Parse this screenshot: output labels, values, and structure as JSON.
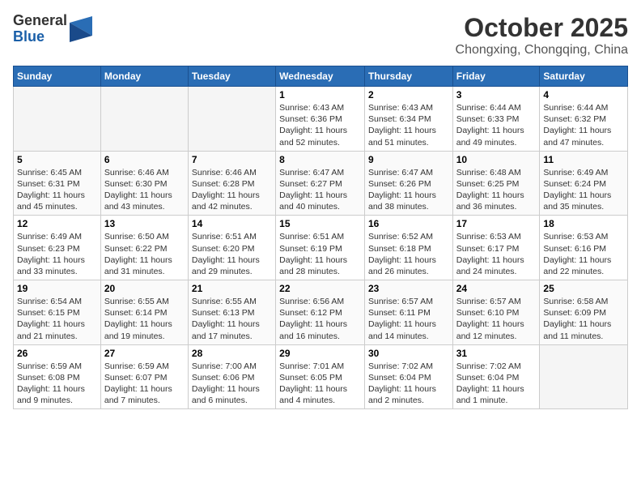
{
  "header": {
    "logo_general": "General",
    "logo_blue": "Blue",
    "month_title": "October 2025",
    "subtitle": "Chongxing, Chongqing, China"
  },
  "weekdays": [
    "Sunday",
    "Monday",
    "Tuesday",
    "Wednesday",
    "Thursday",
    "Friday",
    "Saturday"
  ],
  "weeks": [
    [
      {
        "day": "",
        "info": ""
      },
      {
        "day": "",
        "info": ""
      },
      {
        "day": "",
        "info": ""
      },
      {
        "day": "1",
        "info": "Sunrise: 6:43 AM\nSunset: 6:36 PM\nDaylight: 11 hours\nand 52 minutes."
      },
      {
        "day": "2",
        "info": "Sunrise: 6:43 AM\nSunset: 6:34 PM\nDaylight: 11 hours\nand 51 minutes."
      },
      {
        "day": "3",
        "info": "Sunrise: 6:44 AM\nSunset: 6:33 PM\nDaylight: 11 hours\nand 49 minutes."
      },
      {
        "day": "4",
        "info": "Sunrise: 6:44 AM\nSunset: 6:32 PM\nDaylight: 11 hours\nand 47 minutes."
      }
    ],
    [
      {
        "day": "5",
        "info": "Sunrise: 6:45 AM\nSunset: 6:31 PM\nDaylight: 11 hours\nand 45 minutes."
      },
      {
        "day": "6",
        "info": "Sunrise: 6:46 AM\nSunset: 6:30 PM\nDaylight: 11 hours\nand 43 minutes."
      },
      {
        "day": "7",
        "info": "Sunrise: 6:46 AM\nSunset: 6:28 PM\nDaylight: 11 hours\nand 42 minutes."
      },
      {
        "day": "8",
        "info": "Sunrise: 6:47 AM\nSunset: 6:27 PM\nDaylight: 11 hours\nand 40 minutes."
      },
      {
        "day": "9",
        "info": "Sunrise: 6:47 AM\nSunset: 6:26 PM\nDaylight: 11 hours\nand 38 minutes."
      },
      {
        "day": "10",
        "info": "Sunrise: 6:48 AM\nSunset: 6:25 PM\nDaylight: 11 hours\nand 36 minutes."
      },
      {
        "day": "11",
        "info": "Sunrise: 6:49 AM\nSunset: 6:24 PM\nDaylight: 11 hours\nand 35 minutes."
      }
    ],
    [
      {
        "day": "12",
        "info": "Sunrise: 6:49 AM\nSunset: 6:23 PM\nDaylight: 11 hours\nand 33 minutes."
      },
      {
        "day": "13",
        "info": "Sunrise: 6:50 AM\nSunset: 6:22 PM\nDaylight: 11 hours\nand 31 minutes."
      },
      {
        "day": "14",
        "info": "Sunrise: 6:51 AM\nSunset: 6:20 PM\nDaylight: 11 hours\nand 29 minutes."
      },
      {
        "day": "15",
        "info": "Sunrise: 6:51 AM\nSunset: 6:19 PM\nDaylight: 11 hours\nand 28 minutes."
      },
      {
        "day": "16",
        "info": "Sunrise: 6:52 AM\nSunset: 6:18 PM\nDaylight: 11 hours\nand 26 minutes."
      },
      {
        "day": "17",
        "info": "Sunrise: 6:53 AM\nSunset: 6:17 PM\nDaylight: 11 hours\nand 24 minutes."
      },
      {
        "day": "18",
        "info": "Sunrise: 6:53 AM\nSunset: 6:16 PM\nDaylight: 11 hours\nand 22 minutes."
      }
    ],
    [
      {
        "day": "19",
        "info": "Sunrise: 6:54 AM\nSunset: 6:15 PM\nDaylight: 11 hours\nand 21 minutes."
      },
      {
        "day": "20",
        "info": "Sunrise: 6:55 AM\nSunset: 6:14 PM\nDaylight: 11 hours\nand 19 minutes."
      },
      {
        "day": "21",
        "info": "Sunrise: 6:55 AM\nSunset: 6:13 PM\nDaylight: 11 hours\nand 17 minutes."
      },
      {
        "day": "22",
        "info": "Sunrise: 6:56 AM\nSunset: 6:12 PM\nDaylight: 11 hours\nand 16 minutes."
      },
      {
        "day": "23",
        "info": "Sunrise: 6:57 AM\nSunset: 6:11 PM\nDaylight: 11 hours\nand 14 minutes."
      },
      {
        "day": "24",
        "info": "Sunrise: 6:57 AM\nSunset: 6:10 PM\nDaylight: 11 hours\nand 12 minutes."
      },
      {
        "day": "25",
        "info": "Sunrise: 6:58 AM\nSunset: 6:09 PM\nDaylight: 11 hours\nand 11 minutes."
      }
    ],
    [
      {
        "day": "26",
        "info": "Sunrise: 6:59 AM\nSunset: 6:08 PM\nDaylight: 11 hours\nand 9 minutes."
      },
      {
        "day": "27",
        "info": "Sunrise: 6:59 AM\nSunset: 6:07 PM\nDaylight: 11 hours\nand 7 minutes."
      },
      {
        "day": "28",
        "info": "Sunrise: 7:00 AM\nSunset: 6:06 PM\nDaylight: 11 hours\nand 6 minutes."
      },
      {
        "day": "29",
        "info": "Sunrise: 7:01 AM\nSunset: 6:05 PM\nDaylight: 11 hours\nand 4 minutes."
      },
      {
        "day": "30",
        "info": "Sunrise: 7:02 AM\nSunset: 6:04 PM\nDaylight: 11 hours\nand 2 minutes."
      },
      {
        "day": "31",
        "info": "Sunrise: 7:02 AM\nSunset: 6:04 PM\nDaylight: 11 hours\nand 1 minute."
      },
      {
        "day": "",
        "info": ""
      }
    ]
  ]
}
